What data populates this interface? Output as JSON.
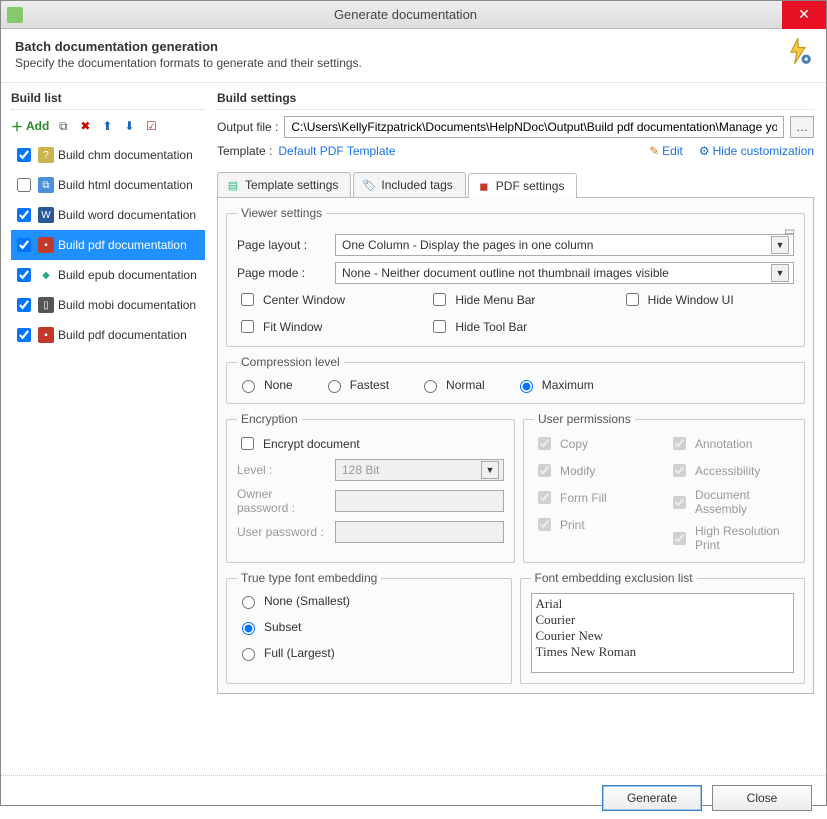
{
  "window": {
    "title": "Generate documentation"
  },
  "header": {
    "title": "Batch documentation generation",
    "subtitle": "Specify the documentation formats to generate and their settings."
  },
  "buildList": {
    "title": "Build list",
    "addLabel": "Add",
    "items": [
      {
        "label": "Build chm documentation",
        "checked": true,
        "icon": "chm",
        "selected": false
      },
      {
        "label": "Build html documentation",
        "checked": false,
        "icon": "html",
        "selected": false
      },
      {
        "label": "Build word documentation",
        "checked": true,
        "icon": "word",
        "selected": false
      },
      {
        "label": "Build pdf documentation",
        "checked": true,
        "icon": "pdf",
        "selected": true
      },
      {
        "label": "Build epub documentation",
        "checked": true,
        "icon": "epub",
        "selected": false
      },
      {
        "label": "Build mobi documentation",
        "checked": true,
        "icon": "mobi",
        "selected": false
      },
      {
        "label": "Build pdf documentation",
        "checked": true,
        "icon": "pdf",
        "selected": false
      }
    ]
  },
  "buildSettings": {
    "title": "Build settings",
    "outputLabel": "Output file :",
    "outputValue": "C:\\Users\\KellyFitzpatrick\\Documents\\HelpNDoc\\Output\\Build pdf documentation\\Manage your Table of C",
    "templateLabel": "Template :",
    "templateValue": "Default PDF Template",
    "editLabel": "Edit",
    "hideCustomLabel": "Hide customization"
  },
  "tabs": [
    {
      "label": "Template settings",
      "active": false
    },
    {
      "label": "Included tags",
      "active": false
    },
    {
      "label": "PDF settings",
      "active": true
    }
  ],
  "pdf": {
    "viewer": {
      "legend": "Viewer settings",
      "pageLayoutLabel": "Page layout :",
      "pageLayoutValue": "One Column - Display the pages in one column",
      "pageModeLabel": "Page mode :",
      "pageModeValue": "None - Neither document outline not thumbnail images visible",
      "centerWindow": "Center Window",
      "fitWindow": "Fit Window",
      "hideMenuBar": "Hide Menu Bar",
      "hideToolBar": "Hide Tool Bar",
      "hideWindowUI": "Hide Window UI"
    },
    "compression": {
      "legend": "Compression level",
      "none": "None",
      "fastest": "Fastest",
      "normal": "Normal",
      "maximum": "Maximum"
    },
    "encryption": {
      "legend": "Encryption",
      "encryptDoc": "Encrypt document",
      "levelLabel": "Level :",
      "levelValue": "128 Bit",
      "ownerPwdLabel": "Owner password :",
      "userPwdLabel": "User password :"
    },
    "permissions": {
      "legend": "User permissions",
      "copy": "Copy",
      "modify": "Modify",
      "formFill": "Form Fill",
      "print": "Print",
      "annotation": "Annotation",
      "accessibility": "Accessibility",
      "docAssembly": "Document Assembly",
      "highResPrint": "High Resolution Print"
    },
    "fontEmbed": {
      "legend": "True type font embedding",
      "noneSmallest": "None (Smallest)",
      "subset": "Subset",
      "fullLargest": "Full (Largest)"
    },
    "fontExclusion": {
      "legend": "Font embedding exclusion list",
      "fonts": [
        "Arial",
        "Courier",
        "Courier New",
        "Times New Roman"
      ]
    }
  },
  "footer": {
    "generate": "Generate",
    "close": "Close"
  }
}
